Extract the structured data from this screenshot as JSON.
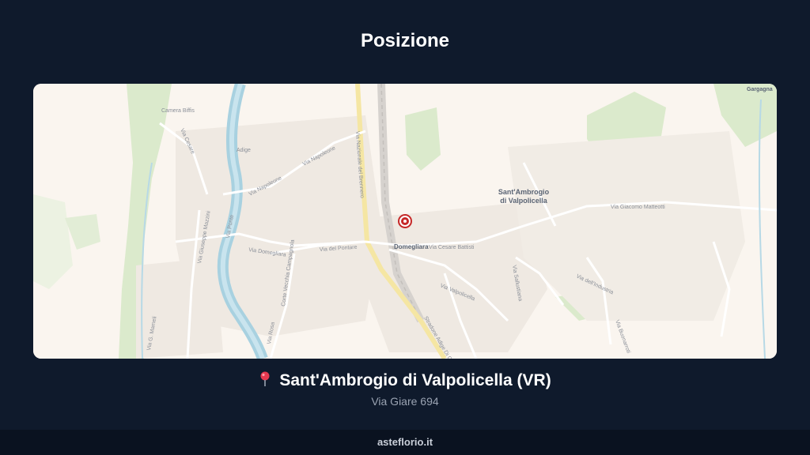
{
  "header": {
    "title": "Posizione"
  },
  "map": {
    "labels": {
      "town": [
        "Sant'Ambrogio",
        "di Valpolicella"
      ],
      "domegliara": "Domegliara",
      "gargagna": "Gargagna",
      "via_cesare_battisti": "Via Cesare Battisti",
      "via_giacomo_matteotti": "Via Giacomo Matteotti",
      "via_napoleone_1": "Via Napoleone",
      "via_napoleone_2": "Via Napoleone",
      "via_nazionale": "Via Nazionale del Brennero",
      "via_del_pontare": "Via del Pontare",
      "via_domegliara": "Via Domegliara",
      "via_valpolicella": "Via Valpolicella",
      "via_industria": "Via dell'Industria",
      "via_cesare": "Via Cesare",
      "via_mameli": "Via G. Mameli",
      "via_ponte": "Via Ponte",
      "strada_adige": "Stradone Adige Di C.",
      "via_sallustiana": "Via Sallustiana",
      "adige": "Adige",
      "camera_bifis": "Camera Biffis",
      "corte_vecchia": "Corte Vecchia Campagnola",
      "via_rosa": "Via Rosa",
      "via_buonarroti": "Via Buonarroti",
      "via_mazzini": "Via Giuseppe Mazzini"
    },
    "marker_icon": "location-marker-icon"
  },
  "location": {
    "pin_icon": "map-pin-icon",
    "name": "Sant'Ambrogio di Valpolicella (VR)",
    "address": "Via Giare 694"
  },
  "footer": {
    "brand": "asteflorio.it"
  },
  "colors": {
    "background": "#0f1a2c",
    "map_base": "#faf5ef",
    "green": "#d9ead3",
    "river": "#a8d1e0",
    "road_major": "#f5e6a3",
    "marker": "#c62828"
  }
}
